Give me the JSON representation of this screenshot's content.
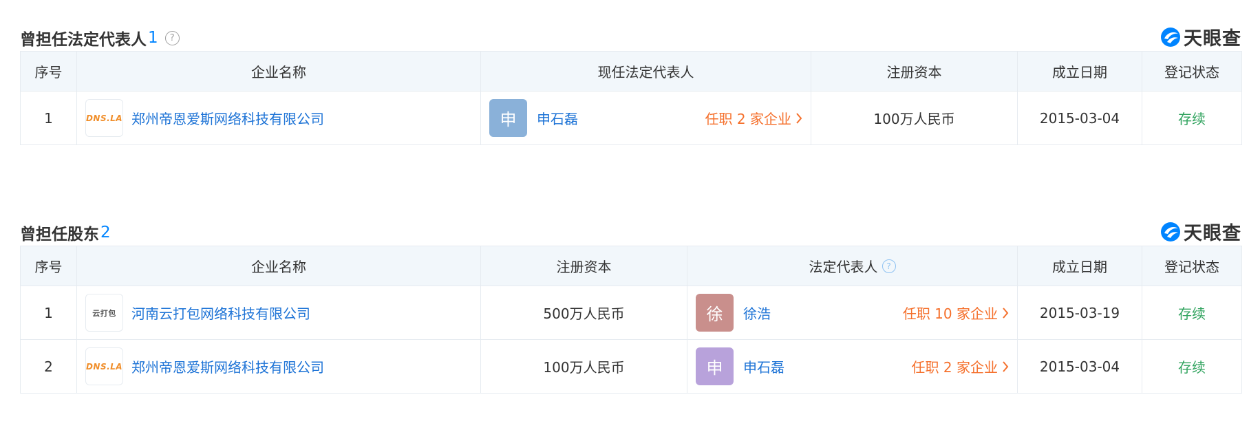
{
  "colors": {
    "accent": "#0084ff",
    "link": "#1d73d6",
    "tenure": "#f5702c",
    "status_active": "#30a35e",
    "header_bg": "#f2f7fb",
    "border": "#e6ebf0"
  },
  "brand": {
    "name": "天眼查",
    "logo_icon": "tianyancha-logo-icon"
  },
  "sections": [
    {
      "title": "曾担任法定代表人",
      "count": "1",
      "has_help": true,
      "columns": [
        "序号",
        "企业名称",
        "现任法定代表人",
        "注册资本",
        "成立日期",
        "登记状态"
      ],
      "rows": [
        {
          "index": "1",
          "logo_text": "DNS.LA",
          "company": "郑州帝恩爱斯网络科技有限公司",
          "person_avatar": "申",
          "person_avatar_color": "#8ab1d9",
          "person": "申石磊",
          "tenure": "任职 2 家企业",
          "capital": "100万人民币",
          "founded": "2015-03-04",
          "status": "存续"
        }
      ]
    },
    {
      "title": "曾担任股东",
      "count": "2",
      "has_help": false,
      "columns": [
        "序号",
        "企业名称",
        "注册资本",
        "法定代表人",
        "成立日期",
        "登记状态"
      ],
      "rows": [
        {
          "index": "1",
          "logo_text": "云打包",
          "company": "河南云打包网络科技有限公司",
          "capital": "500万人民币",
          "person_avatar": "徐",
          "person_avatar_color": "#c98f8c",
          "person": "徐浩",
          "tenure": "任职 10 家企业",
          "founded": "2015-03-19",
          "status": "存续"
        },
        {
          "index": "2",
          "logo_text": "DNS.LA",
          "company": "郑州帝恩爱斯网络科技有限公司",
          "capital": "100万人民币",
          "person_avatar": "申",
          "person_avatar_color": "#b8a2db",
          "person": "申石磊",
          "tenure": "任职 2 家企业",
          "founded": "2015-03-04",
          "status": "存续"
        }
      ]
    }
  ]
}
